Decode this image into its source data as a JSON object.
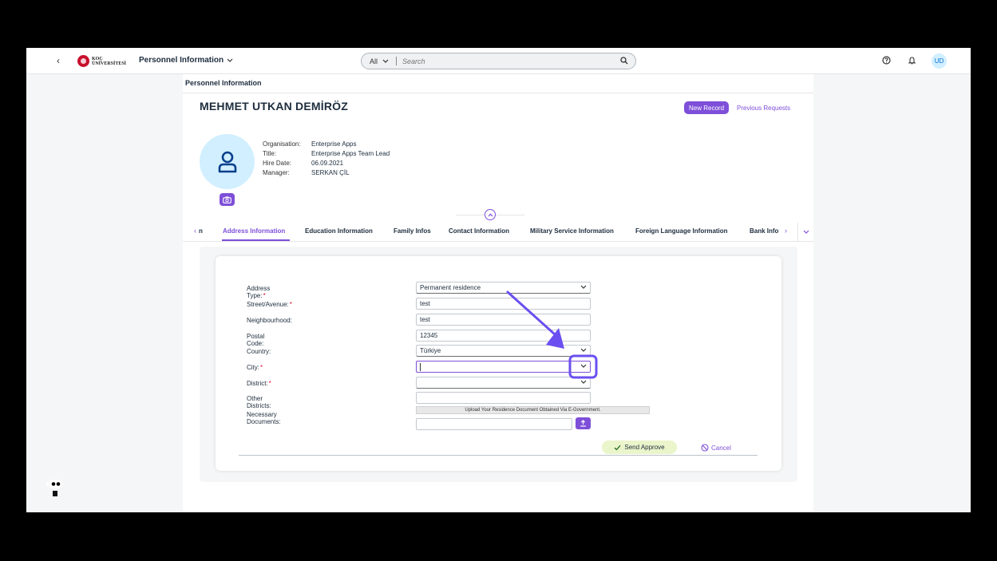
{
  "shell": {
    "logo_line1": "KOÇ",
    "logo_line2": "ÜNİVERSİTESİ",
    "app_title": "Personnel Information",
    "search_scope": "All",
    "search_placeholder": "Search",
    "user_initials": "UD"
  },
  "page": {
    "breadcrumb": "Personnel Information",
    "employee_name": "MEHMET UTKAN DEMİRÖZ",
    "new_record_label": "New Record",
    "previous_requests_label": "Previous Requests",
    "info": [
      {
        "label": "Organisation:",
        "value": "Enterprise Apps"
      },
      {
        "label": "Title:",
        "value": "Enterprise Apps Team Lead"
      },
      {
        "label": "Hire Date:",
        "value": "06.09.2021"
      },
      {
        "label": "Manager:",
        "value": "SERKAN ÇİL"
      }
    ]
  },
  "tabs": {
    "prev_cut": "n",
    "items": [
      {
        "label": "Address Information",
        "active": true
      },
      {
        "label": "Education Information"
      },
      {
        "label": "Family Infos"
      },
      {
        "label": "Contact Information"
      },
      {
        "label": "Military Service Information"
      },
      {
        "label": "Foreign Language Information"
      },
      {
        "label": "Bank Info"
      }
    ]
  },
  "form": {
    "fields": [
      {
        "label": "Address Type:",
        "required": "*",
        "value": "Permanent residence"
      },
      {
        "label": "Street/Avenue:",
        "required": "*",
        "value": "test"
      },
      {
        "label": "Neighbourhood:",
        "required": "",
        "value": "test"
      },
      {
        "label": "Postal Code:",
        "required": "",
        "value": "12345"
      },
      {
        "label": "Country:",
        "required": "",
        "value": "Türkiye"
      },
      {
        "label": "City:",
        "required": "*",
        "value": ""
      },
      {
        "label": "District:",
        "required": "*",
        "value": ""
      },
      {
        "label": "Other Districts:",
        "required": "",
        "value": ""
      },
      {
        "label": "Necessary Documents:",
        "required": "",
        "value": ""
      }
    ],
    "upload_note": "Upload Your Residence Document Obtained Via E-Government.",
    "send_approve_label": "Send Approve",
    "cancel_label": "Cancel"
  },
  "colors": {
    "accent": "#7e4fd9",
    "highlight": "#6b4ff0",
    "approve_bg": "#ebf5cb",
    "required": "#e0102e"
  }
}
